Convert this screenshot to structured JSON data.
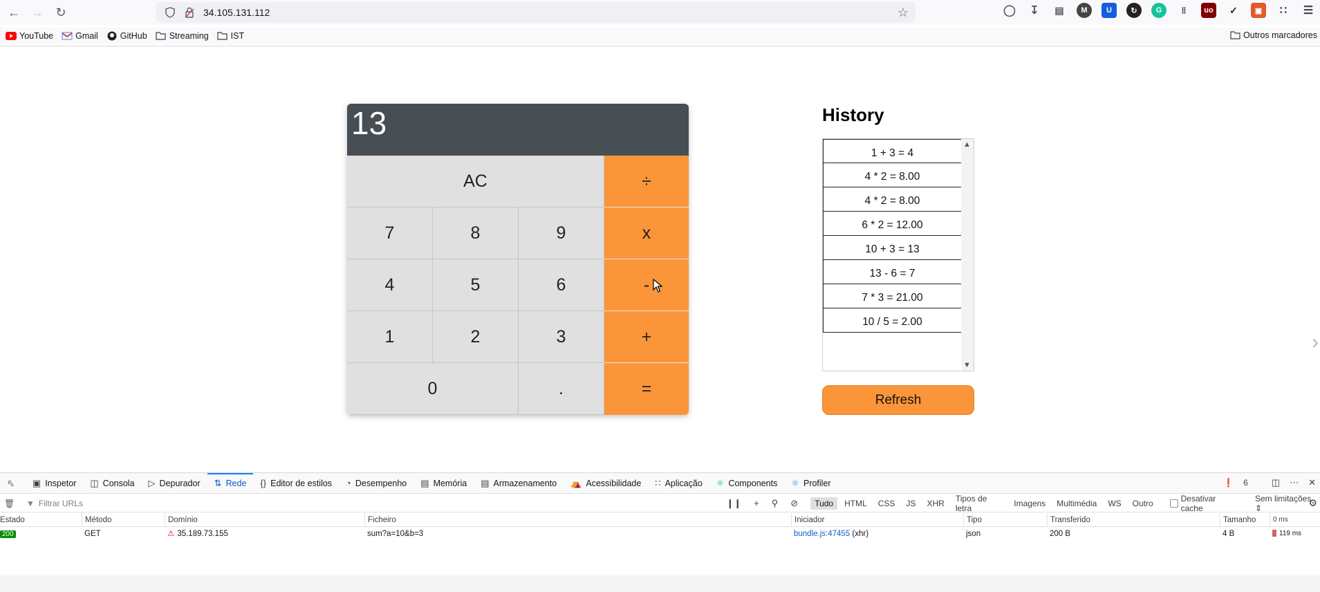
{
  "browser": {
    "url": "34.105.131.112",
    "bookmarks": [
      {
        "label": "YouTube",
        "icon": "youtube-icon"
      },
      {
        "label": "Gmail",
        "icon": "gmail-icon"
      },
      {
        "label": "GitHub",
        "icon": "github-icon"
      },
      {
        "label": "Streaming",
        "icon": "folder-icon"
      },
      {
        "label": "IST",
        "icon": "folder-icon"
      }
    ],
    "other_bookmarks": "Outros marcadores"
  },
  "calculator": {
    "display": "13",
    "keys": {
      "ac": "AC",
      "divide": "÷",
      "multiply": "x",
      "subtract": "-",
      "add": "+",
      "equals": "=",
      "seven": "7",
      "eight": "8",
      "nine": "9",
      "four": "4",
      "five": "5",
      "six": "6",
      "one": "1",
      "two": "2",
      "three": "3",
      "zero": "0",
      "dot": "."
    },
    "colors": {
      "display_bg": "#474e54",
      "operator": "#fb9539",
      "key": "#e0e0e0"
    }
  },
  "history": {
    "title": "History",
    "items": [
      "1 + 3 = 4",
      "4 * 2 = 8.00",
      "4 * 2 = 8.00",
      "6 * 2 = 12.00",
      "10 + 3 = 13",
      "13 - 6 = 7",
      "7 * 3 = 21.00",
      "10 / 5 = 2.00"
    ],
    "refresh_label": "Refresh"
  },
  "devtools": {
    "tabs": [
      "Inspetor",
      "Consola",
      "Depurador",
      "Rede",
      "Editor de estilos",
      "Desempenho",
      "Memória",
      "Armazenamento",
      "Acessibilidade",
      "Aplicação",
      "Components",
      "Profiler"
    ],
    "active_tab": "Rede",
    "error_count": "6",
    "filter_placeholder": "Filtrar URLs",
    "type_filters": [
      "Tudo",
      "HTML",
      "CSS",
      "JS",
      "XHR",
      "Tipos de letra",
      "Imagens",
      "Multimédia",
      "WS",
      "Outro"
    ],
    "disable_cache_label": "Desativar cache",
    "throttling": "Sem limitações ⇕",
    "columns": [
      "Estado",
      "Método",
      "Domínio",
      "Ficheiro",
      "Iniciador",
      "Tipo",
      "Transferido",
      "Tamanho",
      "0 ms"
    ],
    "requests": [
      {
        "status": "200",
        "method": "GET",
        "domain": "35.189.73.155",
        "file": "sum?a=10&b=3",
        "initiator": "bundle.js:47455",
        "initiator_suffix": "(xhr)",
        "type": "json",
        "transferred": "200 B",
        "size": "4 B",
        "timing": "119 ms"
      }
    ]
  }
}
